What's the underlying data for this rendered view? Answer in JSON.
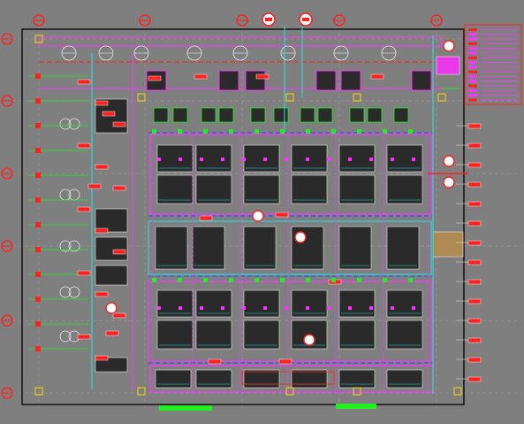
{
  "document": {
    "type": "cad-floor-plan-viewer",
    "text_legibility": "none"
  },
  "colors": {
    "background": "#7f7f7f",
    "wall": "#111111",
    "magenta": "#ff33ff",
    "red": "#ff2020",
    "green": "#22ee22",
    "cyan": "#22e6e6",
    "white": "#e8e8e8",
    "yellow": "#ffd400",
    "blue": "#3355ff",
    "room_fill": "#2a2a2a",
    "tan": "#b08a55"
  },
  "drawing": {
    "grid_bubble_count_top": 7,
    "grid_bubble_count_left": 6,
    "room_blocks": 4,
    "legend_present": true,
    "tags_legible": false
  }
}
